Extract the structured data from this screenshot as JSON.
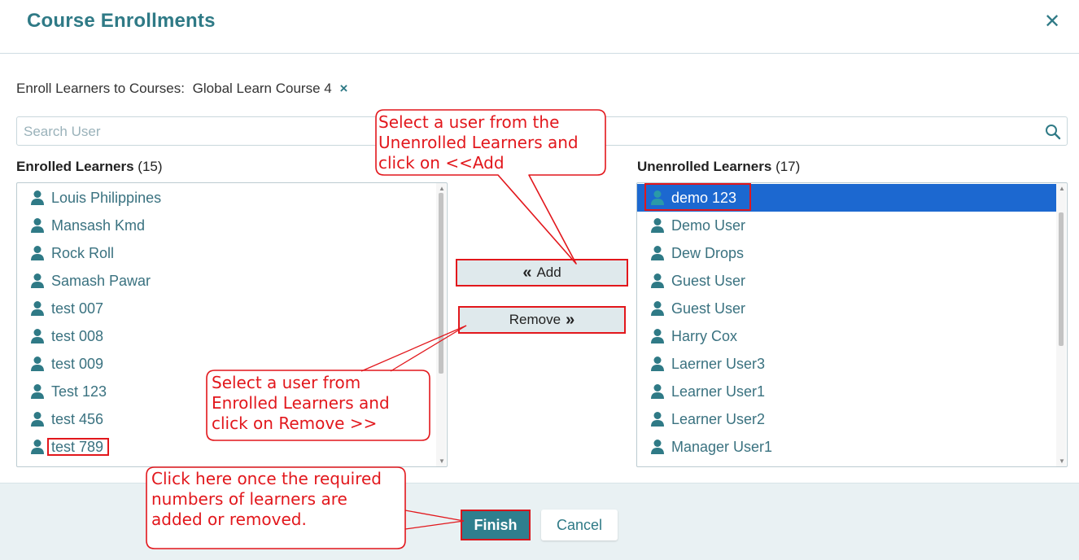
{
  "dialog": {
    "title": "Course Enrollments",
    "close_icon": "close-icon"
  },
  "enroll": {
    "label": "Enroll Learners to Courses:",
    "course": "Global Learn Course 4",
    "remove_chip": "×"
  },
  "search": {
    "placeholder": "Search User",
    "icon": "search-icon"
  },
  "enrolled": {
    "title": "Enrolled Learners",
    "count": "(15)",
    "items": [
      "Louis Philippines",
      "Mansash Kmd",
      "Rock Roll",
      "Samash Pawar",
      "test 007",
      "test 008",
      "test 009",
      "Test 123",
      "test 456",
      "test 789"
    ]
  },
  "unenrolled": {
    "title": "Unenrolled Learners",
    "count": "(17)",
    "selected_index": 0,
    "items": [
      "demo 123",
      "Demo User",
      "Dew Drops",
      "Guest User",
      "Guest User",
      "Harry Cox",
      "Laerner User3",
      "Learner User1",
      "Learner User2",
      "Manager User1"
    ]
  },
  "actions": {
    "add_label": "Add",
    "remove_label": "Remove",
    "add_icon": "double-chevron-left-icon",
    "remove_icon": "double-chevron-right-icon"
  },
  "footer": {
    "finish_label": "Finish",
    "cancel_label": "Cancel"
  },
  "callouts": {
    "add_lines": [
      "Select a user from the",
      "Unenrolled Learners and",
      "click on <<Add"
    ],
    "remove_lines": [
      "Select a user from",
      "Enrolled Learners and",
      "click on Remove >>"
    ],
    "finish_lines": [
      "Click here once the required",
      "numbers of learners are",
      "added or removed."
    ]
  },
  "colors": {
    "accent": "#2f7a86",
    "selected_row": "#1c68d0",
    "callout_red": "#e2171c",
    "footer_bg": "#e9f1f3"
  }
}
